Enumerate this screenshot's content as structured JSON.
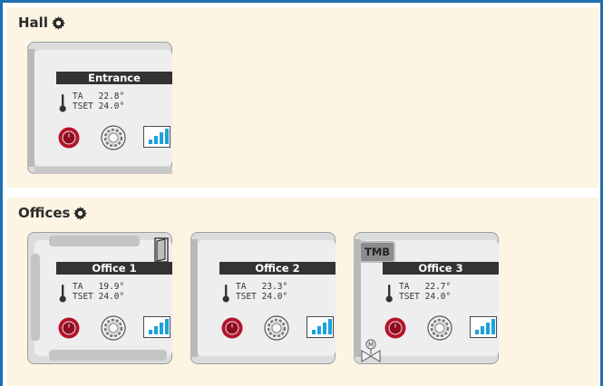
{
  "sections": [
    {
      "title": "Hall",
      "devices": [
        {
          "name": "Entrance",
          "ta_label": "TA",
          "ta_value": "22.8°",
          "tset_label": "TSET",
          "tset_value": "24.0°"
        }
      ]
    },
    {
      "title": "Offices",
      "devices": [
        {
          "name": "Office 1",
          "ta_label": "TA",
          "ta_value": "19.9°",
          "tset_label": "TSET",
          "tset_value": "24.0°"
        },
        {
          "name": "Office 2",
          "ta_label": "TA",
          "ta_value": "23.3°",
          "tset_label": "TSET",
          "tset_value": "24.0°"
        },
        {
          "name": "Office 3",
          "ta_label": "TA",
          "ta_value": "22.7°",
          "tset_label": "TSET",
          "tset_value": "24.0°",
          "badge": "TMB",
          "valve_label": "M"
        }
      ]
    }
  ],
  "icons": {
    "settings": "gear-icon",
    "thermometer": "thermometer-icon",
    "power": "power-icon",
    "fan": "fan-icon",
    "signal": "signal-bars-icon",
    "window": "window-open-icon",
    "valve": "valve-icon"
  },
  "colors": {
    "frame_border": "#1f6fae",
    "section_bg": "#fdf4e3",
    "power_red": "#b5122b",
    "signal_blue": "#1aa3dc",
    "name_bar": "#333333"
  }
}
